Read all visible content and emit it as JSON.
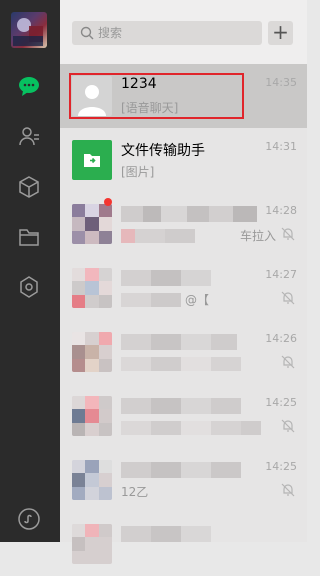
{
  "search": {
    "placeholder": "搜索"
  },
  "add_button": "+",
  "nav": [
    "chat-icon",
    "contacts-icon",
    "box-icon",
    "folder-icon",
    "apps-icon",
    "mini-program-icon"
  ],
  "chats": [
    {
      "name": "1234",
      "last_message": "[语音聊天]",
      "time": "14:35",
      "selected": true
    },
    {
      "name": "文件传输助手",
      "last_message": "[图片]",
      "time": "14:31",
      "selected": false
    },
    {
      "name": "",
      "last_message": "车拉入",
      "time": "14:28",
      "muted": true,
      "unread": true
    },
    {
      "name": "",
      "last_message": "@【",
      "time": "14:27",
      "muted": true
    },
    {
      "name": "",
      "last_message": "",
      "time": "14:26",
      "muted": true
    },
    {
      "name": "",
      "last_message": "",
      "time": "14:25",
      "muted": true
    },
    {
      "name": "",
      "last_message": "12乙",
      "time": "14:25",
      "muted": true
    },
    {
      "name": "",
      "last_message": "",
      "time": "",
      "muted": false
    }
  ],
  "colors": {
    "sidebar": "#2b2b2b",
    "accent_green": "#07c160",
    "selected_row": "#c9c8c7",
    "highlight_frame": "#e0252b"
  }
}
